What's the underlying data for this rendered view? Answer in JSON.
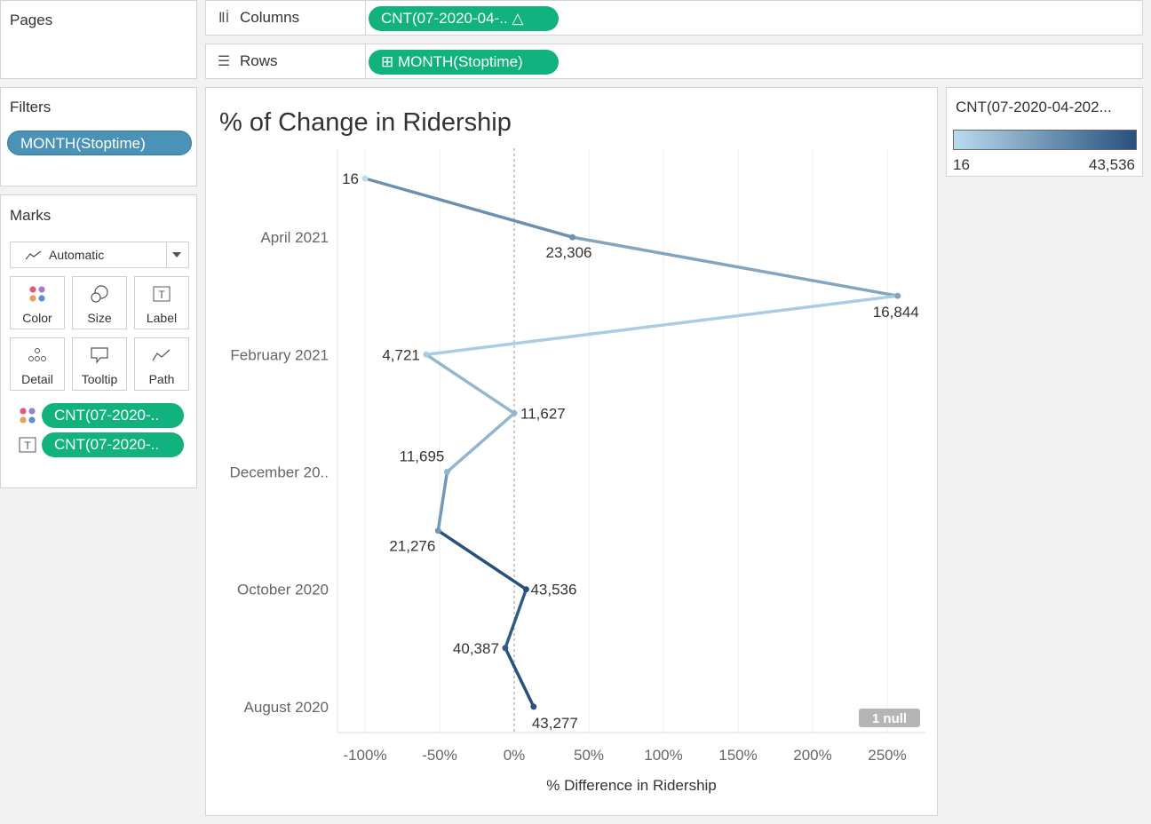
{
  "pages": {
    "title": "Pages"
  },
  "columns": {
    "label": "Columns",
    "pill": "CNT(07-2020-04-.. △"
  },
  "rows": {
    "label": "Rows",
    "pill": "⊞ MONTH(Stoptime)"
  },
  "filters": {
    "title": "Filters",
    "pill": "MONTH(Stoptime)"
  },
  "marks": {
    "title": "Marks",
    "type_select": "Automatic",
    "cards": [
      "Color",
      "Size",
      "Label",
      "Detail",
      "Tooltip",
      "Path"
    ],
    "fields": [
      {
        "icon": "color-dots-icon",
        "label": "CNT(07-2020-.."
      },
      {
        "icon": "label-t-icon",
        "label": "CNT(07-2020-.."
      }
    ]
  },
  "legend": {
    "title": "CNT(07-2020-04-202...",
    "min_label": "16",
    "max_label": "43,536",
    "colors": [
      "#b9dcef",
      "#28507c"
    ]
  },
  "null_badge": "1 null",
  "chart_data": {
    "type": "line",
    "title": "% of Change in Ridership",
    "xlabel": "% Difference in Ridership",
    "ylabel": "",
    "xlim": [
      -110,
      270
    ],
    "x_ticks": [
      "-100%",
      "-50%",
      "0%",
      "50%",
      "100%",
      "150%",
      "200%",
      "250%"
    ],
    "x_tick_values": [
      -100,
      -50,
      0,
      50,
      100,
      150,
      200,
      250
    ],
    "y_tick_labels": [
      "April 2021",
      "February 2021",
      "December 20..",
      "October 2020",
      "August 2020"
    ],
    "points": [
      {
        "month": "May 2021",
        "pct": -100,
        "count": 16,
        "label": "16"
      },
      {
        "month": "April 2021",
        "pct": 39,
        "count": 23306,
        "label": "23,306"
      },
      {
        "month": "March 2021",
        "pct": 257,
        "count": 16844,
        "label": "16,844"
      },
      {
        "month": "February 2021",
        "pct": -59,
        "count": 4721,
        "label": "4,721"
      },
      {
        "month": "January 2021",
        "pct": 0,
        "count": 11627,
        "label": "11,627"
      },
      {
        "month": "December 2020",
        "pct": -45,
        "count": 11695,
        "label": "11,695"
      },
      {
        "month": "November 2020",
        "pct": -51,
        "count": 21276,
        "label": "21,276"
      },
      {
        "month": "October 2020",
        "pct": 8,
        "count": 43536,
        "label": "43,536"
      },
      {
        "month": "September 2020",
        "pct": -6,
        "count": 40387,
        "label": "40,387"
      },
      {
        "month": "August 2020",
        "pct": 13,
        "count": 43277,
        "label": "43,277"
      }
    ],
    "color_range": [
      16,
      43536
    ]
  }
}
